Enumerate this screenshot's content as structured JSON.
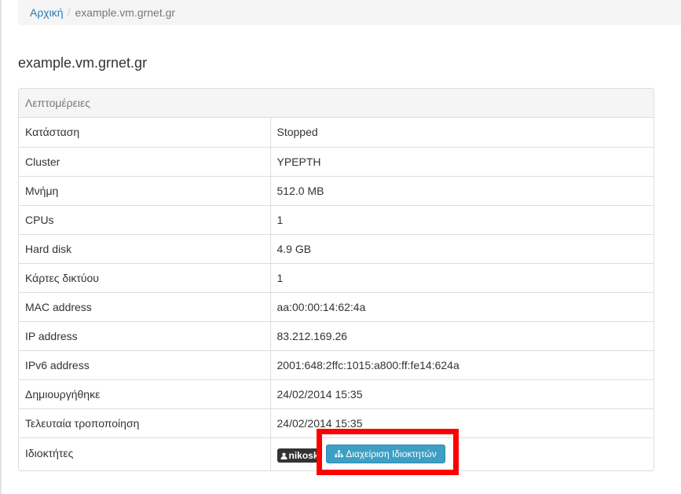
{
  "breadcrumb": {
    "home": "Αρχική",
    "separator": "/",
    "current": "example.vm.grnet.gr"
  },
  "page_title": "example.vm.grnet.gr",
  "panel": {
    "heading": "Λεπτομέρειες",
    "rows": [
      {
        "label": "Κατάσταση",
        "value": "Stopped"
      },
      {
        "label": "Cluster",
        "value": "YPEPTH"
      },
      {
        "label": "Μνήμη",
        "value": "512.0 MB"
      },
      {
        "label": "CPUs",
        "value": "1"
      },
      {
        "label": "Hard disk",
        "value": "4.9 GB"
      },
      {
        "label": "Κάρτες δικτύου",
        "value": "1"
      },
      {
        "label": "MAC address",
        "value": "aa:00:00:14:62:4a"
      },
      {
        "label": "IP address",
        "value": "83.212.169.26"
      },
      {
        "label": "IPv6 address",
        "value": "2001:648:2ffc:1015:a800:ff:fe14:624a"
      },
      {
        "label": "Δημιουργήθηκε",
        "value": "24/02/2014 15:35"
      },
      {
        "label": "Τελευταία τροποποίηση",
        "value": "24/02/2014 15:35"
      }
    ],
    "owners": {
      "label": "Ιδιοκτήτες",
      "owner_badge": "nikosk",
      "owner_icon": "user-icon",
      "manage_button": "Διαχείριση Ιδιοκτητών",
      "manage_icon": "sitemap-icon"
    }
  },
  "colors": {
    "link": "#2a7ab8",
    "button": "#3c9fc3",
    "highlight": "#ff0000",
    "badge": "#333333"
  }
}
